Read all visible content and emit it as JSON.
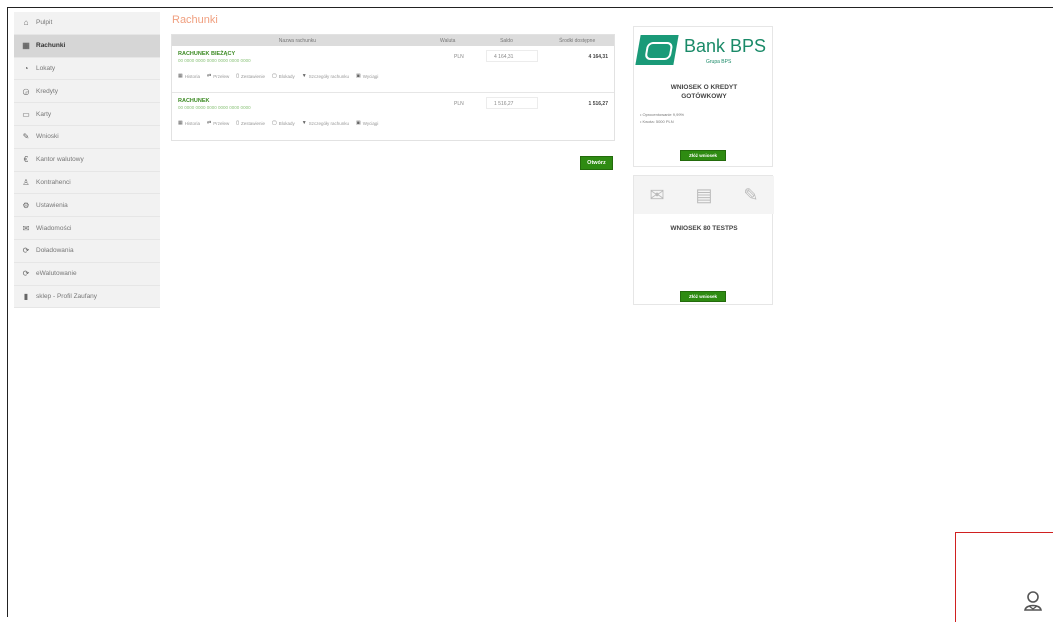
{
  "sidebar": {
    "items": [
      {
        "label": "Pulpit",
        "icon": "home-icon",
        "glyph": "⌂",
        "active": false
      },
      {
        "label": "Rachunki",
        "icon": "accounts-icon",
        "glyph": "▦",
        "active": true
      },
      {
        "label": "Lokaty",
        "icon": "deposit-icon",
        "glyph": "◔",
        "active": false
      },
      {
        "label": "Kredyty",
        "icon": "credit-icon",
        "glyph": "◶",
        "active": false
      },
      {
        "label": "Karty",
        "icon": "card-icon",
        "glyph": "▭",
        "active": false
      },
      {
        "label": "Wnioski",
        "icon": "request-icon",
        "glyph": "✎",
        "active": false
      },
      {
        "label": "Kantor walutowy",
        "icon": "exchange-icon",
        "glyph": "€",
        "active": false
      },
      {
        "label": "Kontrahenci",
        "icon": "contractors-icon",
        "glyph": "♙",
        "active": false
      },
      {
        "label": "Ustawienia",
        "icon": "gear-icon",
        "glyph": "⚙",
        "active": false
      },
      {
        "label": "Wiadomości",
        "icon": "mail-icon",
        "glyph": "✉",
        "active": false
      },
      {
        "label": "Doładowania",
        "icon": "topup-icon",
        "glyph": "⟳",
        "active": false
      },
      {
        "label": "eWalutowanie",
        "icon": "ewallet-icon",
        "glyph": "⟳",
        "active": false
      },
      {
        "label": "sklep - Profil Zaufany",
        "icon": "phone-icon",
        "glyph": "▮",
        "active": false
      }
    ]
  },
  "main": {
    "title": "Rachunki",
    "table": {
      "headers": [
        "Nazwa rachunku",
        "Waluta",
        "Saldo",
        "Środki dostępne"
      ],
      "rows": [
        {
          "name": "RACHUNEK BIEŻĄCY",
          "number": "00 0000 0000 0000 0000 0000 0000",
          "currency": "PLN",
          "saldo": "4 164,31",
          "available": "4 164,31"
        },
        {
          "name": "RACHUNEK",
          "number": "00 0000 0000 0000 0000 0000 0000",
          "currency": "PLN",
          "saldo": "1 516,27",
          "available": "1 516,27"
        }
      ],
      "actions": [
        {
          "label": "Historia",
          "icon": "history-icon",
          "glyph": "▦"
        },
        {
          "label": "Przelew",
          "icon": "transfer-icon",
          "glyph": "⇄"
        },
        {
          "label": "Zestawienie",
          "icon": "statement-icon",
          "glyph": "▯"
        },
        {
          "label": "Blokady",
          "icon": "lock-icon",
          "glyph": "▢"
        },
        {
          "label": "Szczegóły rachunku",
          "icon": "filter-icon",
          "glyph": "▼"
        },
        {
          "label": "Wyciągi",
          "icon": "extract-icon",
          "glyph": "▣"
        }
      ]
    },
    "more_button": "Otwórz"
  },
  "ads": {
    "bank_name": "Bank BPS",
    "bank_sub": "Grupa BPS",
    "ad1_title_line1": "WNIOSEK O KREDYT",
    "ad1_title_line2": "GOTÓWKOWY",
    "ad1_bullet1": "• Oprocentowanie 9,99%",
    "ad1_bullet2": "• Kwota: 5000 PLN",
    "ad1_button": "Złóż wniosek",
    "ad2_title": "WNIOSEK 80 TESTPS",
    "ad2_button": "Złóż wniosek"
  },
  "colors": {
    "accent_green": "#2e8b12",
    "bps_green": "#1a9a78",
    "title_orange": "#f0a080"
  }
}
